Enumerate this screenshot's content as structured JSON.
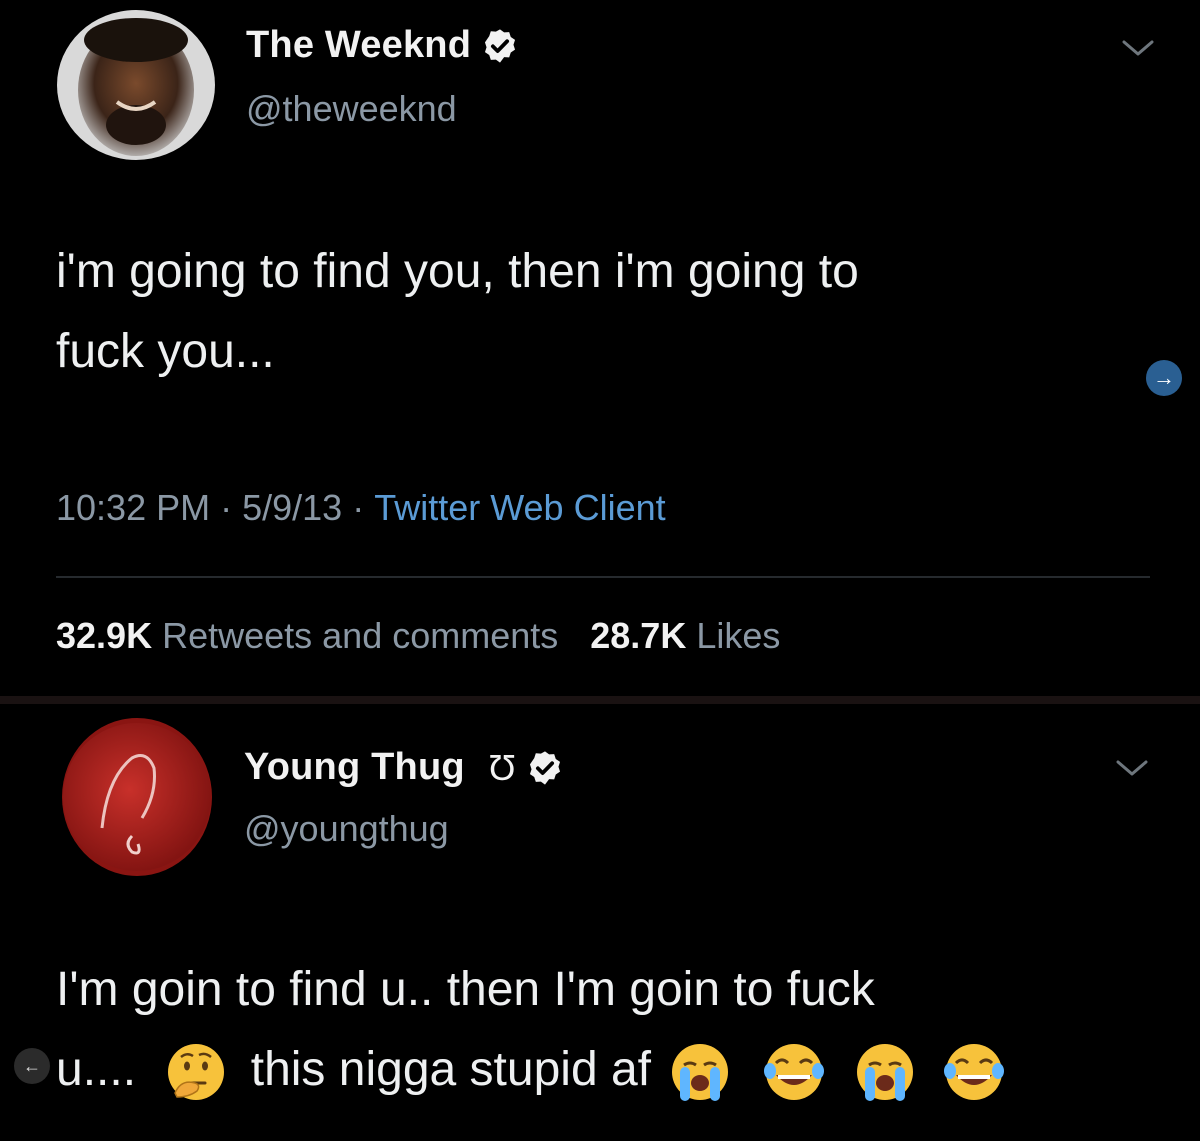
{
  "tweet1": {
    "display_name": "The Weeknd",
    "handle": "@theweeknd",
    "text_line1": "i'm going to find you, then i'm going to",
    "text_line2": "fuck you...",
    "time": "10:32 PM",
    "date": "5/9/13",
    "client": "Twitter Web Client",
    "retweets_count": "32.9K",
    "retweets_label": "Retweets and comments",
    "likes_count": "28.7K",
    "likes_label": "Likes"
  },
  "tweet2": {
    "display_name": "Young Thug",
    "name_symbol": "Ʊ",
    "handle": "@youngthug",
    "text_line1": "I'm goin to find u.. then I'm goin to fuck",
    "text_line2_a": "u....",
    "text_line2_b": "this nigga stupid af"
  },
  "icons": {
    "verified": "verified-badge-icon",
    "chevron": "chevron-down-icon",
    "next": "arrow-right-icon",
    "prev": "arrow-left-icon",
    "emoji1": "thinking-face-emoji",
    "emoji2": "loudly-crying-face-emoji",
    "emoji3": "face-with-tears-of-joy-emoji"
  },
  "colors": {
    "background": "#000000",
    "link": "#5b9bd5",
    "muted": "#8b98a5",
    "accent_circle": "#1d9bf0"
  }
}
